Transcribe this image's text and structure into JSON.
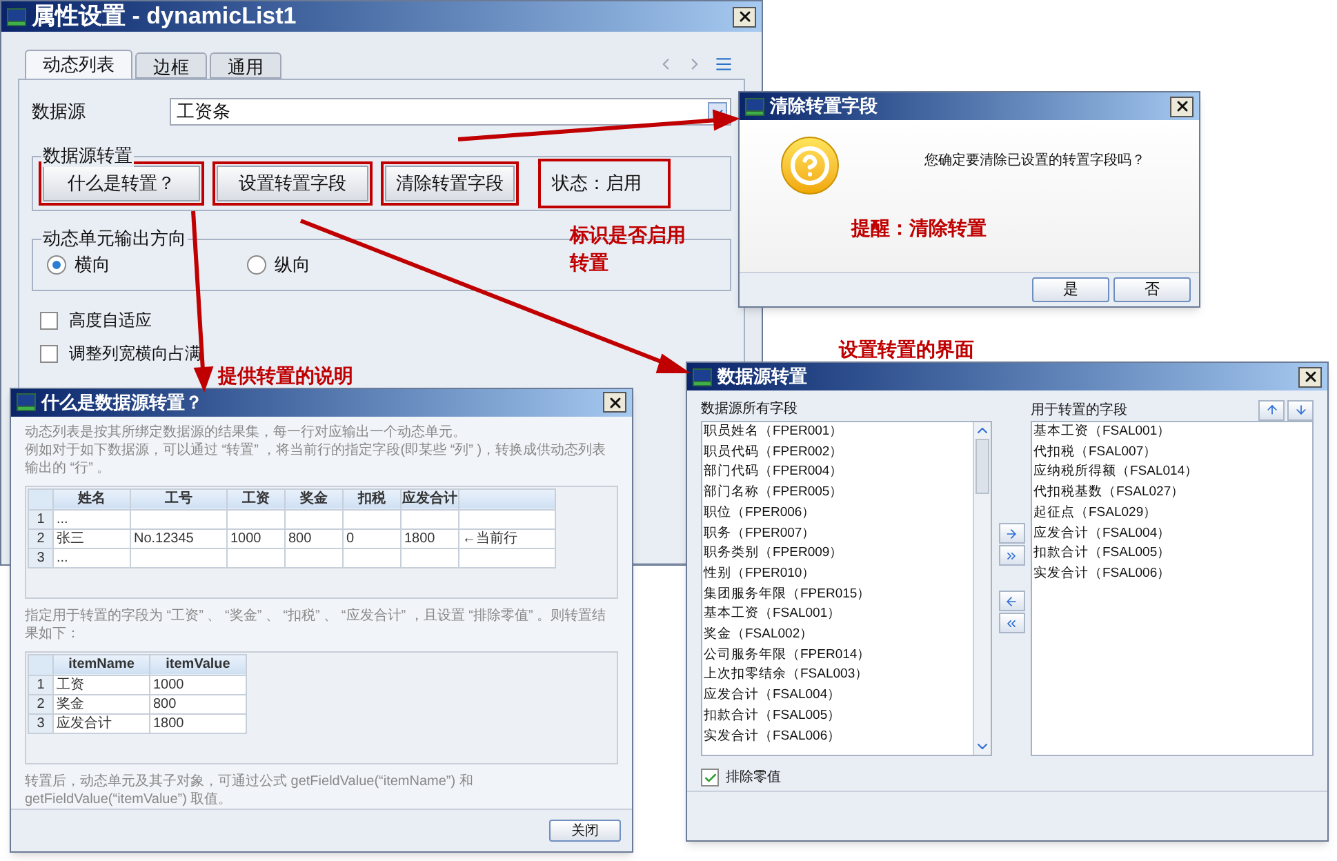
{
  "main_window": {
    "title": "属性设置 - dynamicList1",
    "tabs": [
      {
        "label": "动态列表",
        "selected": true
      },
      {
        "label": "边框",
        "selected": false
      },
      {
        "label": "通用",
        "selected": false
      }
    ],
    "datasource": {
      "label": "数据源",
      "value": "工资条"
    },
    "transpose_group": {
      "title": "数据源转置",
      "buttons": [
        "什么是转置？",
        "设置转置字段",
        "清除转置字段"
      ],
      "status": "状态：启用"
    },
    "direction_group": {
      "title": "动态单元输出方向",
      "options": [
        {
          "label": "横向",
          "selected": true
        },
        {
          "label": "纵向",
          "selected": false
        }
      ]
    },
    "checkboxes": [
      {
        "label": "高度自适应",
        "checked": false
      },
      {
        "label": "调整列宽横向占满",
        "checked": false
      }
    ]
  },
  "clear_dialog": {
    "title": "清除转置字段",
    "message": "您确定要清除已设置的转置字段吗？",
    "buttons": [
      "是",
      "否"
    ]
  },
  "help_dialog": {
    "title": "什么是数据源转置？",
    "paragraphs": [
      "动态列表是按其所绑定数据源的结果集，每一行对应输出一个动态单元。",
      "例如对于如下数据源，可以通过 “转置” ，将当前行的指定字段(即某些 “列” )，转换成供动态列表输出的 “行” 。"
    ],
    "source_table": {
      "columns": [
        "姓名",
        "工号",
        "工资",
        "奖金",
        "扣税",
        "应发合计"
      ],
      "rows": [
        {
          "index": "1",
          "cells": [
            "...",
            null,
            null,
            null,
            null,
            null,
            null
          ]
        },
        {
          "index": "2",
          "cells": [
            "张三",
            "No.12345",
            "1000",
            "800",
            "0",
            "1800",
            "←当前行"
          ]
        },
        {
          "index": "3",
          "cells": [
            "...",
            null,
            null,
            null,
            null,
            null,
            null
          ]
        }
      ]
    },
    "note": "指定用于转置的字段为 “工资” 、 “奖金” 、 “扣税” 、 “应发合计” ，且设置 “排除零值” 。则转置结果如下：",
    "result_table": {
      "columns": [
        "itemName",
        "itemValue"
      ],
      "rows": [
        {
          "index": "1",
          "cells": [
            "工资",
            "1000"
          ]
        },
        {
          "index": "2",
          "cells": [
            "奖金",
            "800"
          ]
        },
        {
          "index": "3",
          "cells": [
            "应发合计",
            "1800"
          ]
        }
      ]
    },
    "footer_text": "转置后，动态单元及其子对象，可通过公式 getFieldValue(“itemName”) 和 getFieldValue(“itemValue”) 取值。",
    "close_button": "关闭"
  },
  "transpose_dialog": {
    "title": "数据源转置",
    "all_fields_label": "数据源所有字段",
    "all_fields": [
      "职员姓名（FPER001）",
      "职员代码（FPER002）",
      "部门代码（FPER004）",
      "部门名称（FPER005）",
      "职位（FPER006）",
      "职务（FPER007）",
      "职务类别（FPER009）",
      "性别（FPER010）",
      "集团服务年限（FPER015）",
      "基本工资（FSAL001）",
      "奖金（FSAL002）",
      "公司服务年限（FPER014）",
      "上次扣零结余（FSAL003）",
      "应发合计（FSAL004）",
      "扣款合计（FSAL005）",
      "实发合计（FSAL006）"
    ],
    "used_fields_label": "用于转置的字段",
    "used_fields": [
      "基本工资（FSAL001）",
      "代扣税（FSAL007）",
      "应纳税所得额（FSAL014）",
      "代扣税基数（FSAL027）",
      "起征点（FSAL029）",
      "应发合计（FSAL004）",
      "扣款合计（FSAL005）",
      "实发合计（FSAL006）"
    ],
    "exclude_zero": {
      "label": "排除零值",
      "checked": true
    }
  },
  "annotations": [
    "标识是否启用转置",
    "提供转置的说明",
    "提醒：清除转置",
    "设置转置的界面"
  ]
}
